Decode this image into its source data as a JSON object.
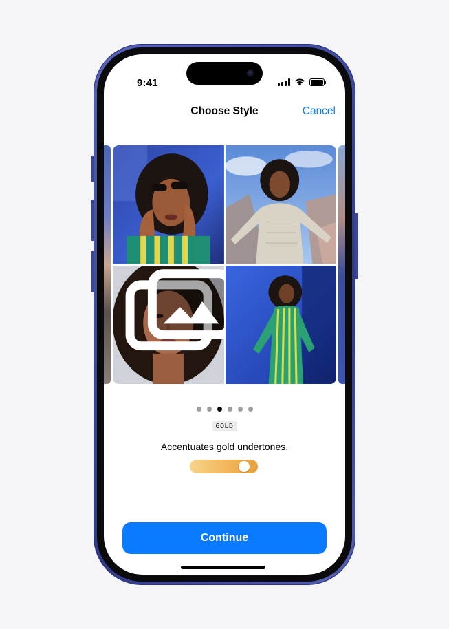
{
  "status_bar": {
    "time": "9:41",
    "icons": [
      "cellular-signal-icon",
      "wifi-icon",
      "battery-icon"
    ]
  },
  "nav": {
    "title": "Choose Style",
    "cancel_label": "Cancel"
  },
  "carousel": {
    "photos": [
      {
        "name": "photo-sunglasses-portrait"
      },
      {
        "name": "photo-sky-pose"
      },
      {
        "name": "photo-closeup-portrait"
      },
      {
        "name": "photo-striped-dress"
      }
    ],
    "photo_badge_icon": "photo-stack-icon",
    "page_count": 6,
    "active_page": 2
  },
  "style": {
    "tag": "GOLD",
    "description": "Accentuates gold undertones.",
    "intensity": 0.87
  },
  "actions": {
    "continue_label": "Continue"
  },
  "colors": {
    "accent": "#0a7aff",
    "slider_start": "#f8d48a",
    "slider_end": "#e9a23d",
    "frame": "#3f4a9c"
  }
}
